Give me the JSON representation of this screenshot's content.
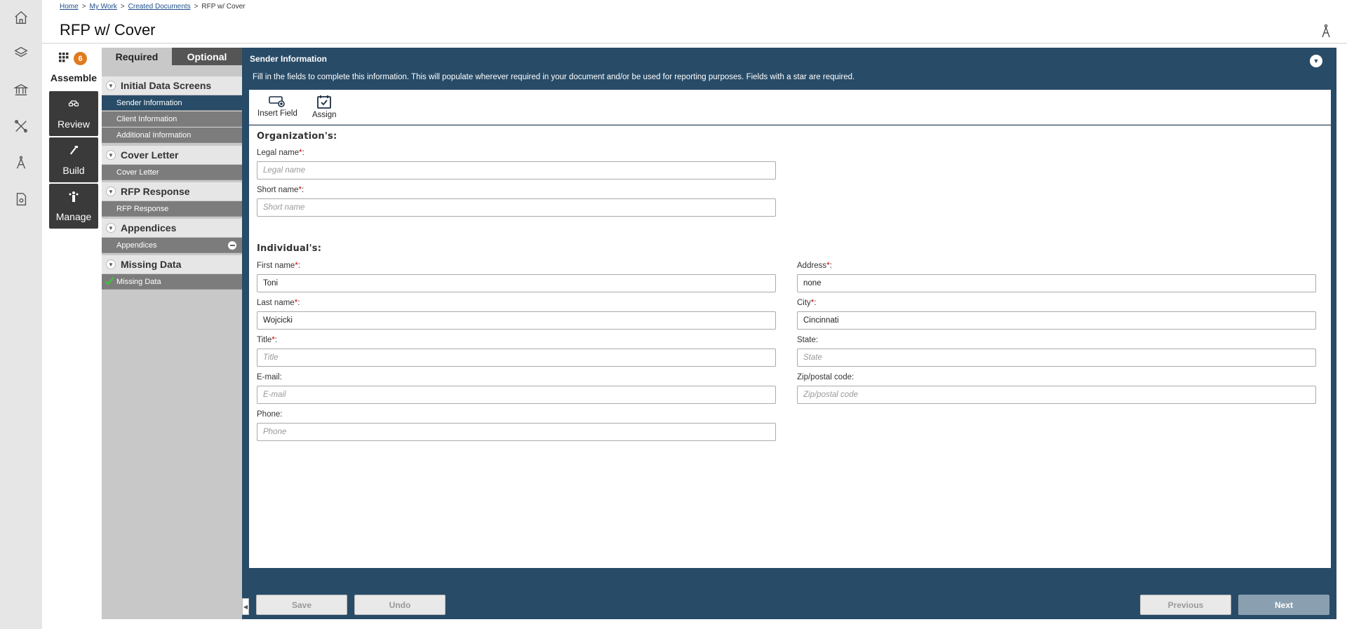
{
  "breadcrumb": {
    "home": "Home",
    "my_work": "My Work",
    "created_documents": "Created Documents",
    "current": "RFP w/ Cover",
    "sep": ">"
  },
  "page_title": "RFP w/ Cover",
  "phases": {
    "assemble": {
      "label": "Assemble",
      "badge": "6"
    },
    "review": {
      "label": "Review"
    },
    "build": {
      "label": "Build"
    },
    "manage": {
      "label": "Manage"
    }
  },
  "rail_icons": [
    "home-icon",
    "layers-icon",
    "bank-icon",
    "tools-icon",
    "compass-icon",
    "document-settings-icon"
  ],
  "nav": {
    "tabs": {
      "required": "Required",
      "optional": "Optional"
    },
    "sections": [
      {
        "title": "Initial Data Screens",
        "items": [
          "Sender Information",
          "Client Information",
          "Additional Information"
        ]
      },
      {
        "title": "Cover Letter",
        "items": [
          "Cover Letter"
        ]
      },
      {
        "title": "RFP Response",
        "items": [
          "RFP Response"
        ]
      },
      {
        "title": "Appendices",
        "items": [
          "Appendices"
        ]
      },
      {
        "title": "Missing Data",
        "items": [
          "Missing Data"
        ]
      }
    ]
  },
  "content": {
    "title": "Sender Information",
    "description": "Fill in the fields to complete this information. This will populate wherever required in your document and/or be used for reporting purposes. Fields with a star are required."
  },
  "toolbar": {
    "insert_field": "Insert Field",
    "assign": "Assign"
  },
  "form": {
    "org_title": "Organization's:",
    "ind_title": "Individual's:",
    "legal_name": {
      "label": "Legal name",
      "star": "*",
      "colon": ":",
      "placeholder": "Legal name",
      "value": ""
    },
    "short_name": {
      "label": "Short name",
      "star": "*",
      "colon": ":",
      "placeholder": "Short name",
      "value": ""
    },
    "first_name": {
      "label": "First name",
      "star": "*",
      "colon": ":",
      "placeholder": "First name",
      "value": "Toni"
    },
    "last_name": {
      "label": "Last name",
      "star": "*",
      "colon": ":",
      "placeholder": "Last name",
      "value": "Wojcicki"
    },
    "title": {
      "label": "Title",
      "star": "*",
      "colon": ":",
      "placeholder": "Title",
      "value": ""
    },
    "email": {
      "label": "E-mail:",
      "placeholder": "E-mail",
      "value": ""
    },
    "phone": {
      "label": "Phone:",
      "placeholder": "Phone",
      "value": ""
    },
    "address": {
      "label": "Address",
      "star": "*",
      "colon": ":",
      "placeholder": "Address",
      "value": "none"
    },
    "city": {
      "label": "City",
      "star": "*",
      "colon": ":",
      "placeholder": "City",
      "value": "Cincinnati"
    },
    "state": {
      "label": "State:",
      "placeholder": "State",
      "value": ""
    },
    "zip": {
      "label": "Zip/postal code:",
      "placeholder": "Zip/postal code",
      "value": ""
    }
  },
  "footer": {
    "save": "Save",
    "undo": "Undo",
    "previous": "Previous",
    "next": "Next"
  },
  "colors": {
    "panel": "#284b67",
    "badge": "#e07a1f",
    "required_star": "#cc0000"
  }
}
